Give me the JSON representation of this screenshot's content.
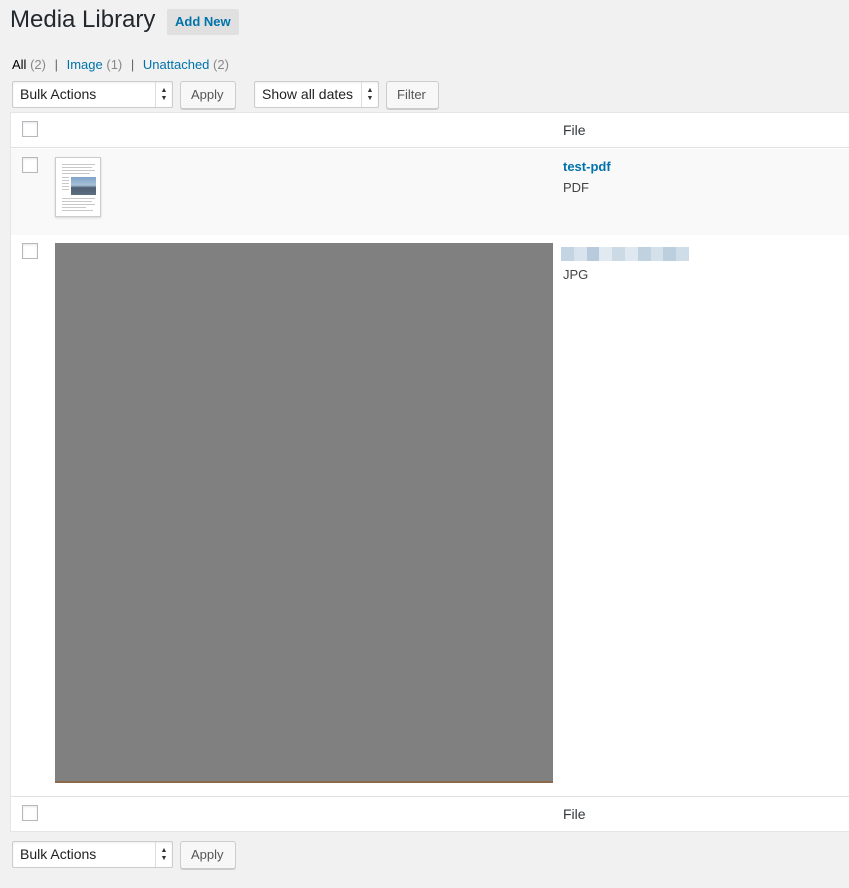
{
  "header": {
    "title": "Media Library",
    "add_new": "Add New"
  },
  "views": {
    "all_label": "All",
    "all_count": "(2)",
    "image_label": "Image",
    "image_count": "(1)",
    "unattached_label": "Unattached",
    "unattached_count": "(2)",
    "separator": "|"
  },
  "top_nav": {
    "bulk_actions": "Bulk Actions",
    "apply": "Apply",
    "date_filter": "Show all dates",
    "filter": "Filter"
  },
  "table": {
    "column_file": "File",
    "rows": [
      {
        "title": "test-pdf",
        "type": "PDF",
        "thumbnail_icon": "pdf-document-thumbnail"
      },
      {
        "title": "",
        "type": "JPG",
        "thumbnail_icon": "image-thumbnail",
        "title_obscured": true
      }
    ]
  },
  "bottom_nav": {
    "bulk_actions": "Bulk Actions",
    "apply": "Apply"
  },
  "colors": {
    "link": "#0073aa",
    "background": "#f1f1f1",
    "image_placeholder": "#808080"
  }
}
